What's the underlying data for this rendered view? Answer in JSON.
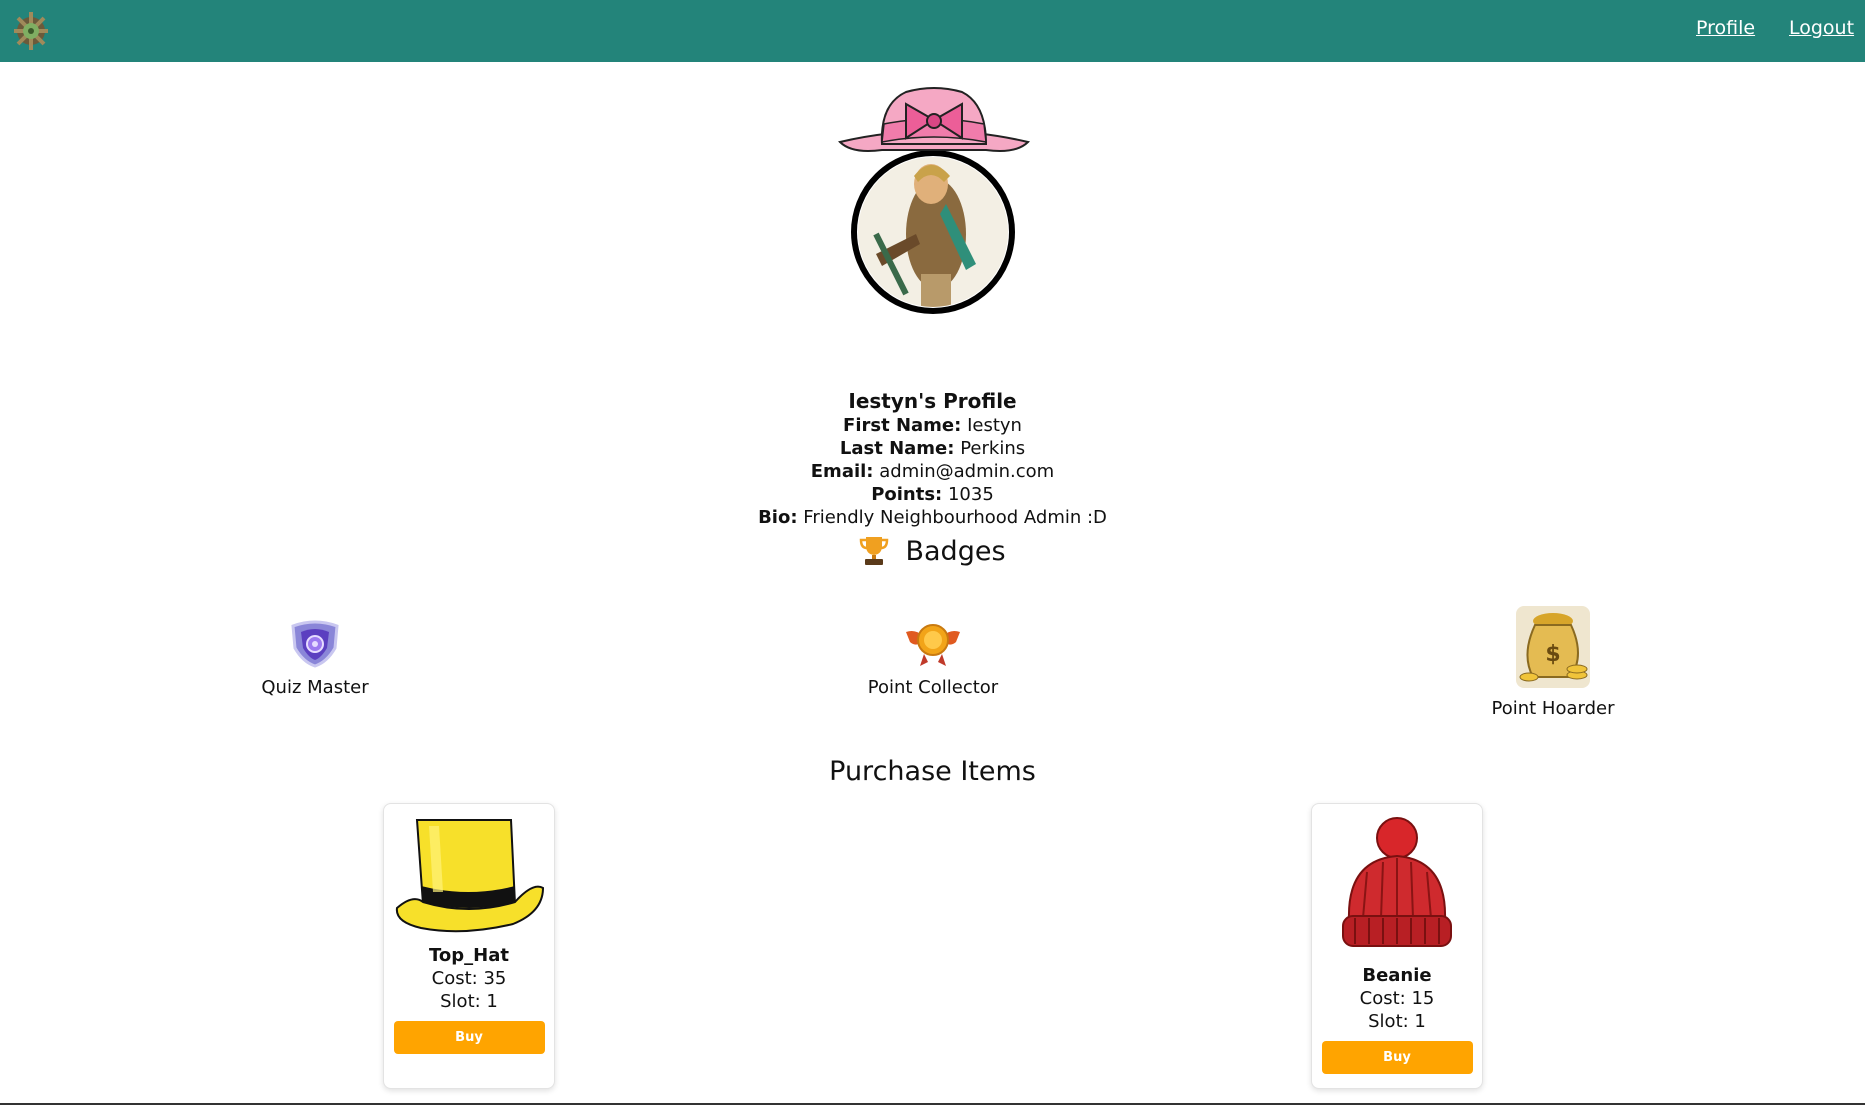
{
  "nav": {
    "logo_icon": "app-logo-icon",
    "profile_label": "Profile",
    "logout_label": "Logout"
  },
  "colors": {
    "topbar": "#23847a",
    "buy_button": "#ffa400"
  },
  "avatar": {
    "hat_icon": "pink-bow-hat",
    "portrait_icon": "character-portrait"
  },
  "profile": {
    "title": "Iestyn's Profile",
    "first_name_label": "First Name:",
    "first_name": "Iestyn",
    "last_name_label": "Last Name:",
    "last_name": "Perkins",
    "email_label": "Email:",
    "email": "admin@admin.com",
    "points_label": "Points:",
    "points": "1035",
    "bio_label": "Bio:",
    "bio": "Friendly Neighbourhood Admin :D"
  },
  "badges": {
    "heading": "Badges",
    "heading_icon": "trophy-icon",
    "items": [
      {
        "label": "Quiz Master",
        "icon": "shield-badge-icon"
      },
      {
        "label": "Point Collector",
        "icon": "winged-medal-icon"
      },
      {
        "label": "Point Hoarder",
        "icon": "money-bag-icon"
      }
    ]
  },
  "purchase": {
    "heading": "Purchase Items",
    "items": [
      {
        "name": "Top_Hat",
        "cost": "Cost: 35",
        "slot": "Slot: 1",
        "buy_label": "Buy",
        "icon": "yellow-top-hat"
      },
      {
        "name": "Beanie",
        "cost": "Cost: 15",
        "slot": "Slot: 1",
        "buy_label": "Buy",
        "icon": "red-beanie"
      }
    ]
  }
}
